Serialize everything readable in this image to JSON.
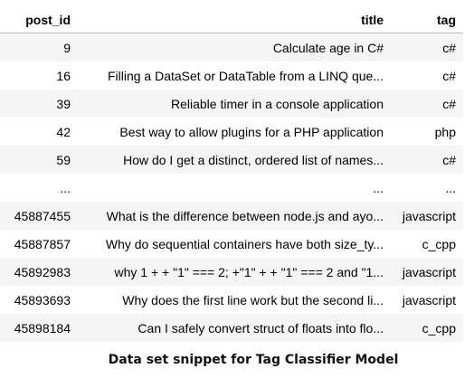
{
  "table": {
    "headers": [
      "post_id",
      "title",
      "tag"
    ],
    "rows": [
      {
        "post_id": "9",
        "title": "Calculate age in C#",
        "tag": "c#"
      },
      {
        "post_id": "16",
        "title": "Filling a DataSet or DataTable from a LINQ que...",
        "tag": "c#"
      },
      {
        "post_id": "39",
        "title": "Reliable timer in a console application",
        "tag": "c#"
      },
      {
        "post_id": "42",
        "title": "Best way to allow plugins for a PHP application",
        "tag": "php"
      },
      {
        "post_id": "59",
        "title": "How do I get a distinct, ordered list of names...",
        "tag": "c#"
      },
      {
        "post_id": "...",
        "title": "...",
        "tag": "..."
      },
      {
        "post_id": "45887455",
        "title": "What is the difference between node.js and ayo...",
        "tag": "javascript"
      },
      {
        "post_id": "45887857",
        "title": "Why do sequential containers have both size_ty...",
        "tag": "c_cpp"
      },
      {
        "post_id": "45892983",
        "title": "why 1 + + \"1\" === 2; +\"1\" + + \"1\" === 2 and \"1...",
        "tag": "javascript"
      },
      {
        "post_id": "45893693",
        "title": "Why does the first line work but the second li...",
        "tag": "javascript"
      },
      {
        "post_id": "45898184",
        "title": "Can I safely convert struct of floats into flo...",
        "tag": "c_cpp"
      }
    ]
  },
  "caption": "Data set snippet for Tag Classifier Model"
}
